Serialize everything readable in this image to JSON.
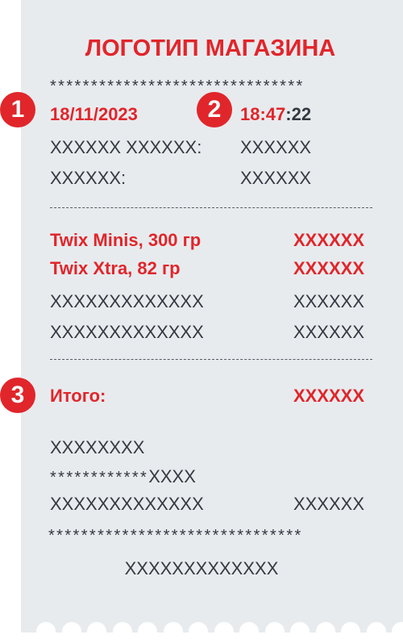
{
  "receipt": {
    "store_logo": "ЛОГОТИП МАГАЗИНА",
    "stars_top": "*******************************",
    "date": "18/11/2023",
    "time_hm": "18:47",
    "time_sec": ":22",
    "meta_rows": [
      {
        "label": "XXXXXX XXXXXX:",
        "value": "XXXXXX"
      },
      {
        "label": "XXXXXX:",
        "value": "XXXXXX"
      }
    ],
    "items": [
      {
        "name": "Twix Minis, 300 гр",
        "price": "XXXXXX"
      },
      {
        "name": "Twix Xtra, 82 гр",
        "price": "XXXXXX"
      },
      {
        "name": "XXXXXXXXXXXXX",
        "price": "XXXXXX"
      },
      {
        "name": "XXXXXXXXXXXXX",
        "price": "XXXXXX"
      }
    ],
    "total_label": "Итого:",
    "total_value": "XXXXXX",
    "footer_line1": "XXXXXXXX",
    "card_stars": "************",
    "card_last": "XXXX",
    "footer_row": {
      "label": "XXXXXXXXXXXXX",
      "value": "XXXXXX"
    },
    "stars_bottom": "*******************************",
    "footer_code": "XXXXXXXXXXXXX"
  },
  "markers": [
    "1",
    "2",
    "3"
  ],
  "colors": {
    "accent": "#e0262b",
    "paper": "#e8ebee",
    "text": "#333a41"
  }
}
